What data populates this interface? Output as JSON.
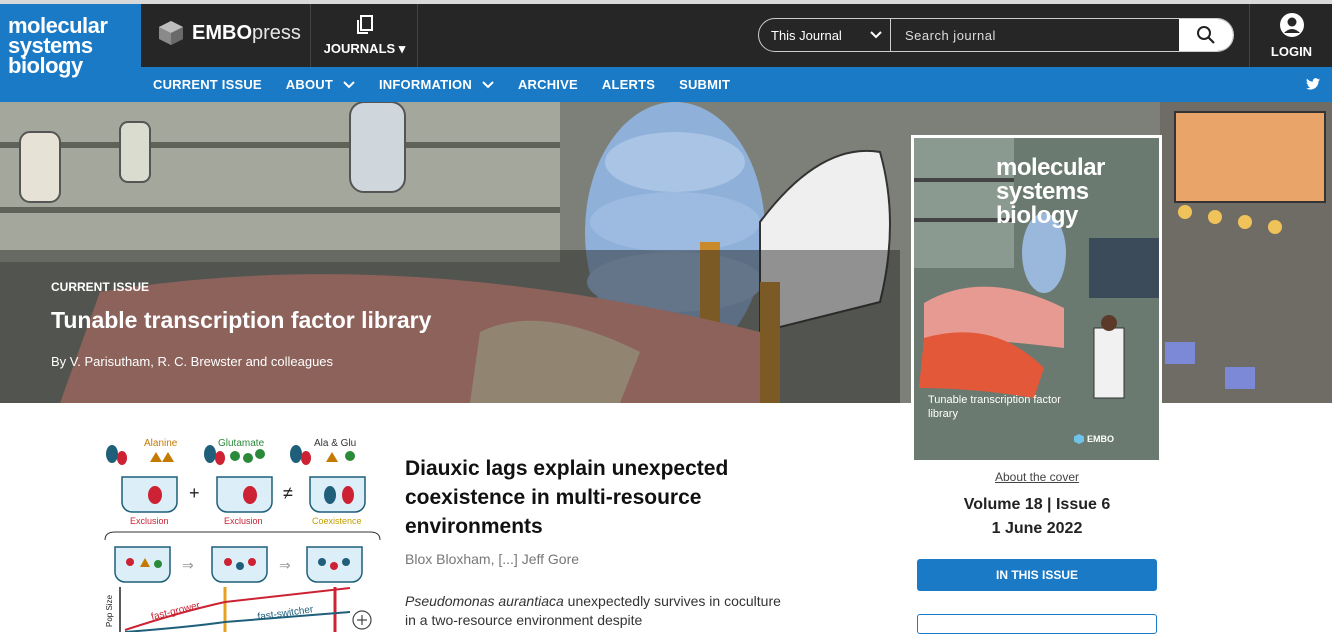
{
  "logo": {
    "line1": "molecular",
    "line2": "systems",
    "line3": "biology"
  },
  "publisher": {
    "name_bold": "EMBO",
    "name_rest": "press"
  },
  "journals_menu": {
    "label": "JOURNALS"
  },
  "search": {
    "scope": "This Journal",
    "placeholder": "Search journal"
  },
  "login": {
    "label": "LOGIN"
  },
  "nav": {
    "current_issue": "CURRENT ISSUE",
    "about": "ABOUT",
    "information": "INFORMATION",
    "archive": "ARCHIVE",
    "alerts": "ALERTS",
    "submit": "SUBMIT"
  },
  "hero": {
    "label": "CURRENT ISSUE",
    "title": "Tunable transcription factor library",
    "authors": "By V. Parisutham, R. C. Brewster and colleagues"
  },
  "cover": {
    "title1": "molecular",
    "title2": "systems",
    "title3": "biology",
    "subtitle1": "Tunable transcription factor",
    "subtitle2": "library",
    "brand": "EMBO",
    "about_link": "About the cover",
    "volume": "Volume 18 | Issue 6",
    "date": "1 June 2022",
    "in_issue_button": "IN THIS ISSUE"
  },
  "article": {
    "title": "Diauxic lags explain unexpected coexistence in multi-resource environments",
    "authors": "Blox Bloxham, [...] Jeff Gore",
    "abstract_species": "Pseudomonas aurantiaca",
    "abstract_rest": " unexpectedly survives in coculture in a two-resource environment despite",
    "figure": {
      "alanine": "Alanine",
      "glutamate": "Glutamate",
      "ala_glu": "Ala & Glu",
      "exclusion1": "Exclusion",
      "exclusion2": "Exclusion",
      "coexistence": "Coexistence",
      "pop_size": "Pop Size",
      "fast_grower": "fast-grower",
      "fast_switcher": "fast-switcher"
    }
  },
  "colors": {
    "brand_blue": "#1a7ac6",
    "topbar": "#262626"
  }
}
